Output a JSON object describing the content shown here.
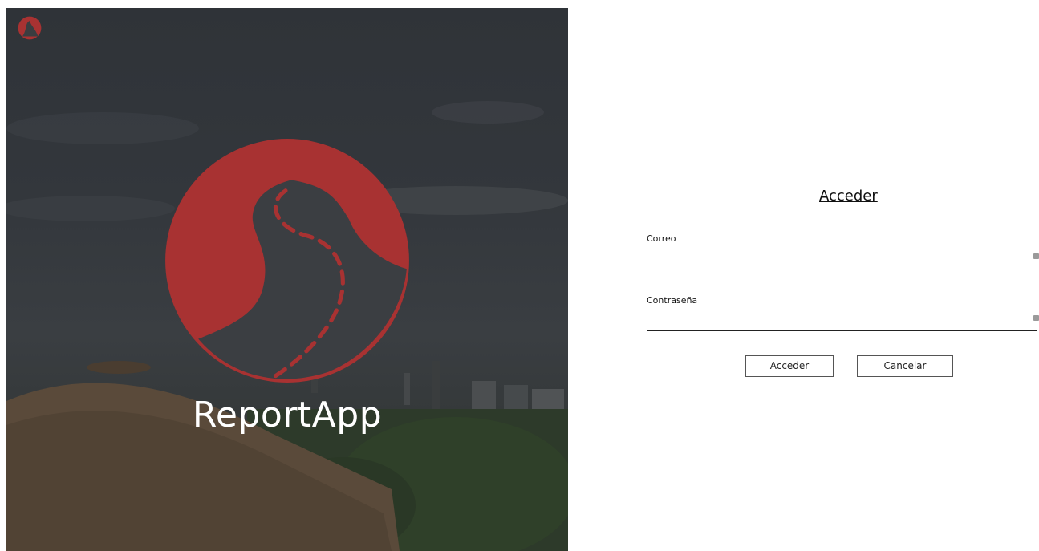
{
  "brand": {
    "name": "ReportApp",
    "logo_icon": "road-icon",
    "accent_color": "#a83232"
  },
  "login": {
    "title": "Acceder",
    "email": {
      "label": "Correo",
      "value": "",
      "icon": "autofill-icon"
    },
    "password": {
      "label": "Contraseña",
      "value": "",
      "icon": "autofill-icon"
    },
    "submit_label": "Acceder",
    "cancel_label": "Cancelar"
  }
}
